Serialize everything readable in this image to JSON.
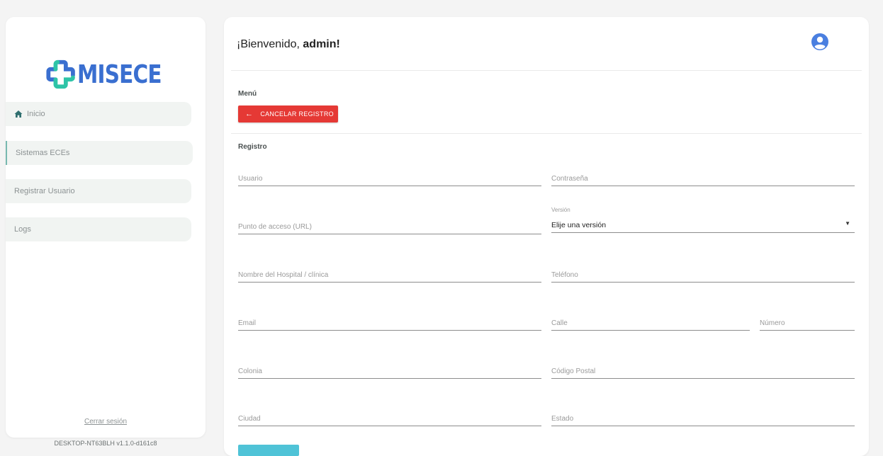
{
  "brand": {
    "name": "MISECE",
    "color": "#3a6fd0",
    "accent": "#2ec4a7"
  },
  "sidebar": {
    "items": [
      {
        "label": "Inicio",
        "icon": "home-icon"
      },
      {
        "label": "Sistemas ECEs"
      },
      {
        "label": "Registrar Usuario"
      },
      {
        "label": "Logs"
      }
    ],
    "logout": "Cerrar sesión",
    "version": "DESKTOP-NT63BLH v1.1.0-d161c8"
  },
  "header": {
    "greeting": "¡Bienvenido, ",
    "user": "admin!",
    "user_icon": "user-circle-icon"
  },
  "menu": {
    "title": "Menú",
    "cancel_label": "CANCELAR REGISTRO",
    "cancel_color": "#e53935"
  },
  "form": {
    "title": "Registro",
    "usuario": "Usuario",
    "contrasena": "Contraseña",
    "punto_acceso": "Punto de acceso (URL)",
    "version_label": "Versión",
    "version_value": "Elije una versión",
    "hospital": "Nombre del Hospital / clínica",
    "telefono": "Teléfono",
    "email": "Email",
    "calle": "Calle",
    "numero": "Número",
    "colonia": "Colonia",
    "codigo_postal": "Código Postal",
    "ciudad": "Ciudad",
    "estado": "Estado"
  }
}
